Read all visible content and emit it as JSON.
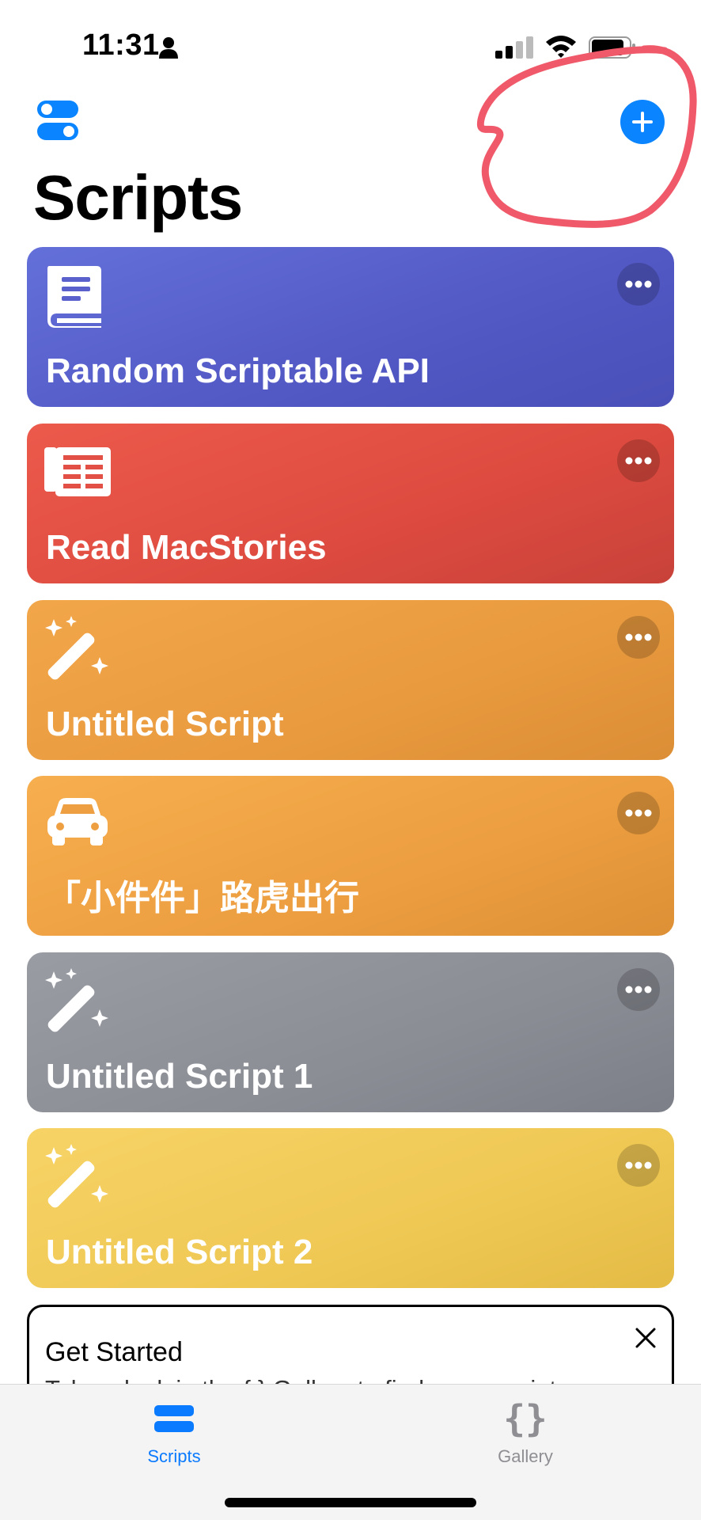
{
  "status_bar": {
    "time": "11:31",
    "icons": [
      "person-icon",
      "cellular-signal-icon",
      "wifi-icon",
      "battery-icon"
    ]
  },
  "header": {
    "title": "Scripts",
    "left_icon": "toggles-icon",
    "right_icon": "plus-icon",
    "accent_color": "#0a84ff",
    "annotation": {
      "shape": "hand-drawn circle",
      "color": "#f0596a"
    }
  },
  "scripts": [
    {
      "title": "Random Scriptable API",
      "icon": "book-icon",
      "color": "#5a60cc"
    },
    {
      "title": "Read MacStories",
      "icon": "newspaper-icon",
      "color": "#e24f44"
    },
    {
      "title": "Untitled Script",
      "icon": "magic-wand-icon",
      "color": "#e99a3e"
    },
    {
      "title": "「小件件」路虎出行",
      "icon": "car-icon",
      "color": "#ee9f42"
    },
    {
      "title": "Untitled Script 1",
      "icon": "magic-wand-icon",
      "color": "#8b8d95"
    },
    {
      "title": "Untitled Script 2",
      "icon": "magic-wand-icon",
      "color": "#efc854"
    }
  ],
  "get_started": {
    "title": "Get Started",
    "body": "Take a look in the { } Gallery to find some scripts"
  },
  "tab_bar": {
    "tabs": [
      {
        "label": "Scripts",
        "icon": "scripts-stack-icon",
        "active": true,
        "color": "#0a7aff"
      },
      {
        "label": "Gallery",
        "icon": "curly-braces-icon",
        "active": false,
        "color": "#8e8e93"
      }
    ]
  }
}
